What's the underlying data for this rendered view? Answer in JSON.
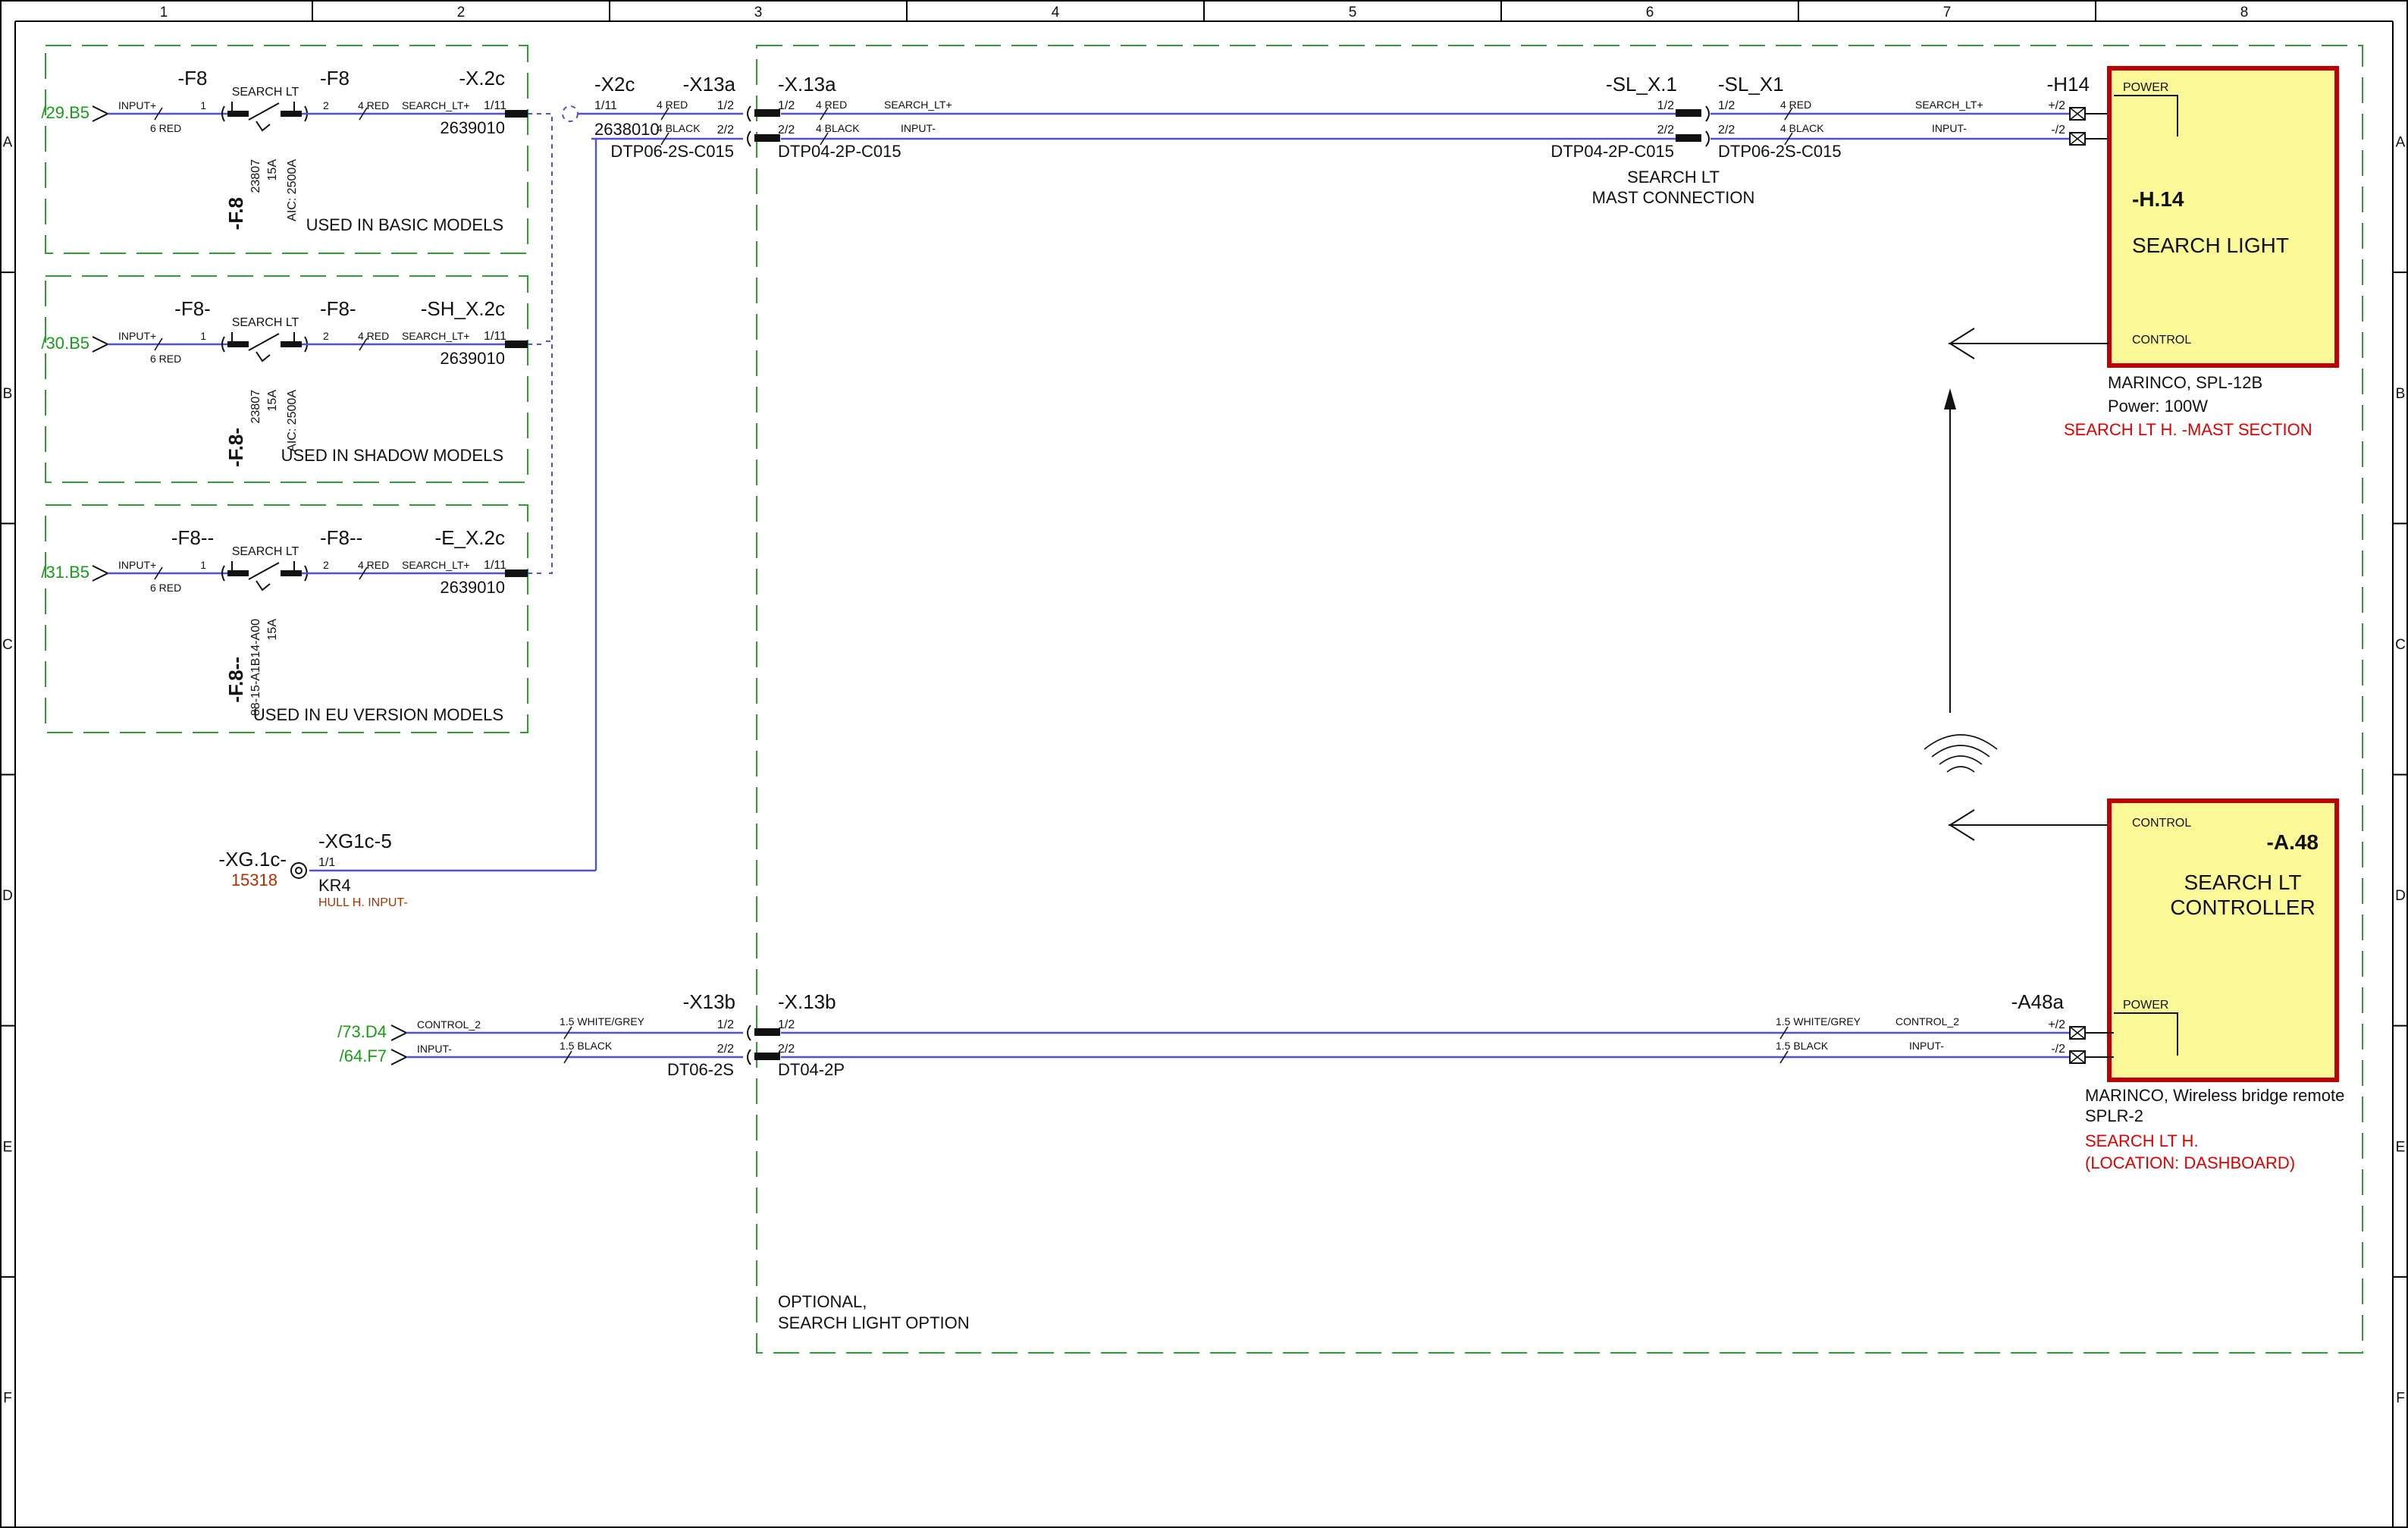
{
  "grid": {
    "columns": [
      "1",
      "2",
      "3",
      "4",
      "5",
      "6",
      "7",
      "8"
    ],
    "rows": [
      "A",
      "B",
      "C",
      "D",
      "E",
      "F"
    ]
  },
  "fuse_groups": [
    {
      "ref_in": "/29.B5",
      "fuse_label": "-F8",
      "switch_tag": "SEARCH LT",
      "fuse_out_label": "-F8",
      "connector": "-X.2c",
      "part_no": "2639010",
      "pin": "1/11",
      "wire_in": "INPUT+",
      "wire_in_spec": "6 RED",
      "wire_out": "SEARCH_LT+",
      "wire_out_spec": "4 RED",
      "pin_left": "1",
      "pin_right": "2",
      "fuse_vertical": "-F.8",
      "fuse_specs": [
        "23807",
        "15A"
      ],
      "aic": "AIC: 2500A",
      "note": "USED IN BASIC MODELS"
    },
    {
      "ref_in": "/30.B5",
      "fuse_label": "-F8-",
      "switch_tag": "SEARCH LT",
      "fuse_out_label": "-F8-",
      "connector": "-SH_X.2c",
      "part_no": "2639010",
      "pin": "1/11",
      "wire_in": "INPUT+",
      "wire_in_spec": "6 RED",
      "wire_out": "SEARCH_LT+",
      "wire_out_spec": "4 RED",
      "pin_left": "1",
      "pin_right": "2",
      "fuse_vertical": "-F.8-",
      "fuse_specs": [
        "23807",
        "15A"
      ],
      "aic": "AIC: 2500A",
      "note": "USED IN SHADOW MODELS"
    },
    {
      "ref_in": "/31.B5",
      "fuse_label": "-F8--",
      "switch_tag": "SEARCH LT",
      "fuse_out_label": "-F8--",
      "connector": "-E_X.2c",
      "part_no": "2639010",
      "pin": "1/11",
      "wire_in": "INPUT+",
      "wire_in_spec": "6 RED",
      "wire_out": "SEARCH_LT+",
      "wire_out_spec": "4 RED",
      "pin_left": "1",
      "pin_right": "2",
      "fuse_vertical": "-F.8--",
      "fuse_specs": [
        "88-15-A1B14-A00",
        "15A"
      ],
      "aic": "",
      "note": "USED IN EU VERSION MODELS"
    }
  ],
  "x2c": {
    "label": "-X2c",
    "pin": "1/11",
    "part_no": "2638010"
  },
  "x13a": {
    "label_left": "-X13a",
    "label_right": "-X.13a",
    "pin1": "1/2",
    "pin2": "2/2",
    "part_left": "DTP06-2S-C015",
    "part_right": "DTP04-2P-C015",
    "wire1_spec": "4 RED",
    "wire2_spec": "4 BLACK",
    "wire1": "SEARCH_LT+",
    "wire2": "INPUT-"
  },
  "sl_x1": {
    "label_left": "-SL_X.1",
    "label_right": "-SL_X1",
    "pin1": "1/2",
    "pin2": "2/2",
    "part_left": "DTP04-2P-C015",
    "part_right": "DTP06-2S-C015",
    "desc_line1": "SEARCH LT",
    "desc_line2": "MAST CONNECTION",
    "wire1_spec": "4 RED",
    "wire2_spec": "4 BLACK",
    "wire1": "SEARCH_LT+",
    "wire2": "INPUT-"
  },
  "h14": {
    "term_label": "-H14",
    "pin_plus": "+/2",
    "pin_minus": "-/2",
    "power": "POWER",
    "control": "CONTROL",
    "id": "-H.14",
    "name": "SEARCH LIGHT",
    "maker": "MARINCO, SPL-12B",
    "power_rating": "Power: 100W",
    "section": "SEARCH LT H. -MAST  SECTION"
  },
  "xg1c": {
    "label": "-XG.1c-",
    "code": "15318",
    "conn": "-XG1c-5",
    "pin": "1/1",
    "wire": "KR4",
    "note": "HULL H. INPUT-"
  },
  "x13b": {
    "ref1": "/73.D4",
    "ref2": "/64.F7",
    "wire1": "CONTROL_2",
    "wire2": "INPUT-",
    "wire1_spec": "1.5 WHITE/GREY",
    "wire2_spec": "1.5 BLACK",
    "label_left": "-X13b",
    "label_right": "-X.13b",
    "pin1": "1/2",
    "pin2": "2/2",
    "part_left": "DT06-2S",
    "part_right": "DT04-2P"
  },
  "a48": {
    "term_label": "-A48a",
    "pin_plus": "+/2",
    "pin_minus": "-/2",
    "wire1_spec": "1.5 WHITE/GREY",
    "wire2_spec": "1.5 BLACK",
    "wire1": "CONTROL_2",
    "wire2": "INPUT-",
    "control": "CONTROL",
    "power": "POWER",
    "id": "-A.48",
    "name_line1": "SEARCH LT",
    "name_line2": "CONTROLLER",
    "maker": "MARINCO, Wireless bridge remote",
    "model": "SPLR-2",
    "location1": "SEARCH LT H.",
    "location2": "(LOCATION: DASHBOARD)"
  },
  "optional": {
    "line1": "OPTIONAL,",
    "line2": "SEARCH LIGHT OPTION"
  }
}
